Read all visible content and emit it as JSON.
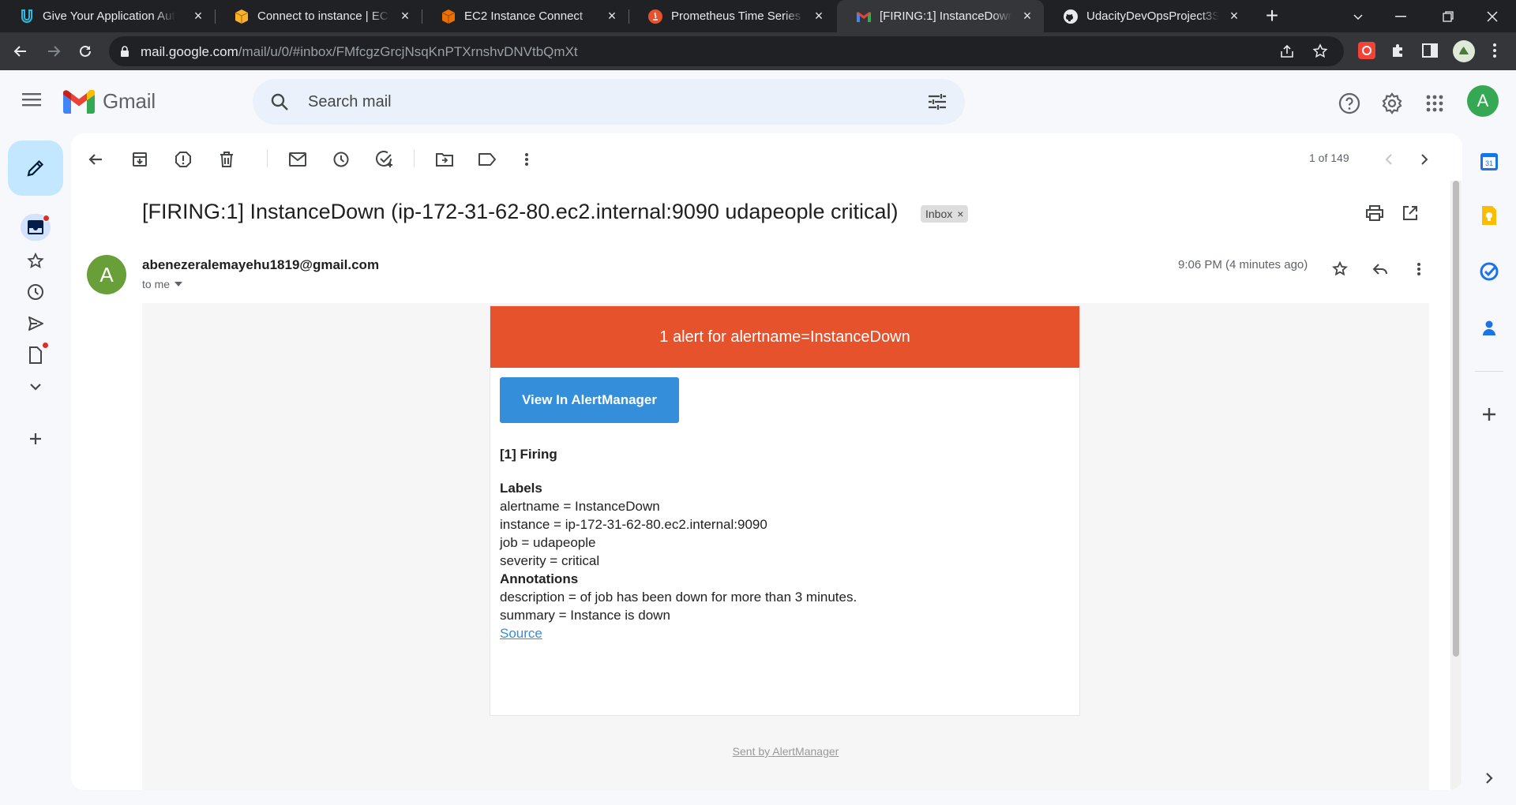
{
  "browser": {
    "tabs": [
      {
        "title": "Give Your Application Auto",
        "favicon": "udacity-icon",
        "active": false
      },
      {
        "title": "Connect to instance | EC2 M",
        "favicon": "aws-cube-icon",
        "active": false
      },
      {
        "title": "EC2 Instance Connect",
        "favicon": "aws-ec2-icon",
        "active": false
      },
      {
        "title": "Prometheus Time Series Co",
        "favicon": "prometheus-icon",
        "active": false
      },
      {
        "title": "[FIRING:1] InstanceDown (ip",
        "favicon": "gmail-icon",
        "active": true
      },
      {
        "title": "UdacityDevOpsProject3Setu",
        "favicon": "github-icon",
        "active": false
      }
    ],
    "url_host": "mail.google.com",
    "url_path": "/mail/u/0/#inbox/FMfcgzGrcjNsqKnPTXrnshvDNVtbQmXt"
  },
  "gmail": {
    "brand": "Gmail",
    "search_placeholder": "Search mail",
    "user_initial": "A",
    "pager": "1 of 149",
    "subject": "[FIRING:1] InstanceDown (ip-172-31-62-80.ec2.internal:9090 udapeople critical)",
    "label_chip": "Inbox",
    "sender_initial": "A",
    "sender": "abenezeralemayehu1819@gmail.com",
    "to": "to me",
    "time": "9:06 PM (4 minutes ago)"
  },
  "email": {
    "header": "1 alert for alertname=InstanceDown",
    "button": "View In AlertManager",
    "firing": "[1] Firing",
    "labels_title": "Labels",
    "labels": [
      "alertname = InstanceDown",
      "instance = ip-172-31-62-80.ec2.internal:9090",
      "job = udapeople",
      "severity = critical"
    ],
    "annotations_title": "Annotations",
    "annotations": [
      "description = of job has been down for more than 3 minutes.",
      "summary = Instance is down"
    ],
    "source_link": "Source",
    "footer": "Sent by AlertManager"
  },
  "colors": {
    "alert_header": "#e6522c",
    "button": "#348eda",
    "compose": "#c2e7ff",
    "avatar": "#34a853"
  }
}
